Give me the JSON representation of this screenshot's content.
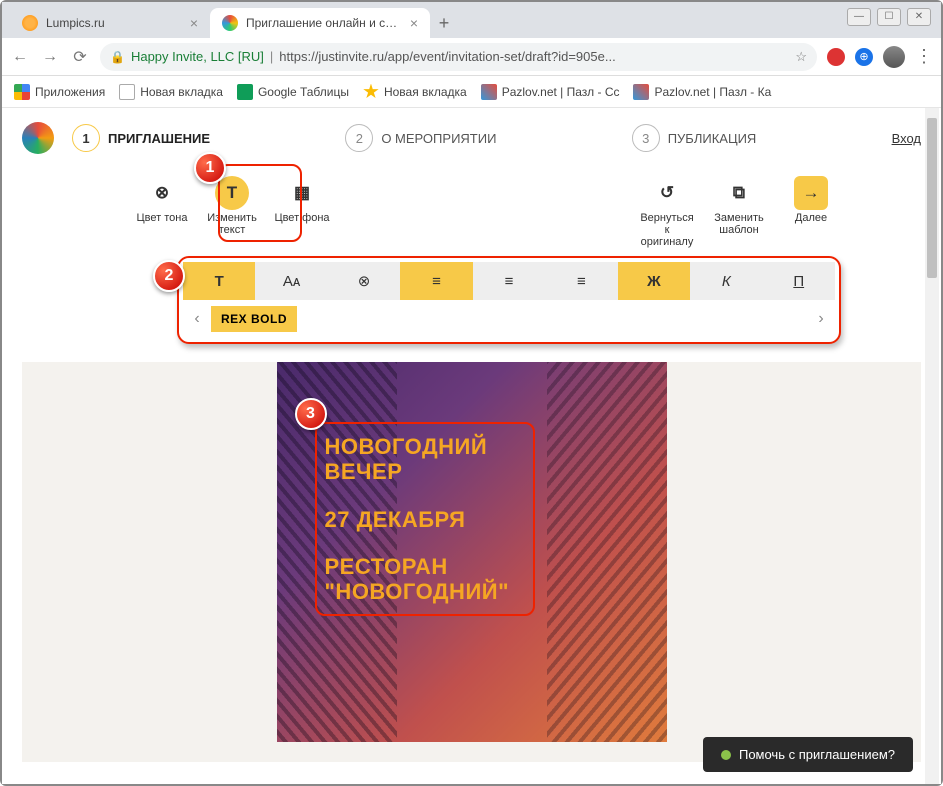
{
  "window": {
    "tabs": [
      {
        "title": "Lumpics.ru"
      },
      {
        "title": "Приглашение онлайн и сайт ме"
      }
    ],
    "url_org": "Happy Invite, LLC [RU]",
    "url_rest": "https://justinvite.ru/app/event/invitation-set/draft?id=905e..."
  },
  "bookmarks": {
    "apps": "Приложения",
    "items": [
      "Новая вкладка",
      "Google Таблицы",
      "Новая вкладка",
      "Pazlov.net | Пазл - Сс",
      "Pazlov.net | Пазл - Ка"
    ]
  },
  "steps": {
    "s1_num": "1",
    "s1_label": "ПРИГЛАШЕНИЕ",
    "s2_num": "2",
    "s2_label": "О МЕРОПРИЯТИИ",
    "s3_num": "3",
    "s3_label": "ПУБЛИКАЦИЯ",
    "login": "Вход"
  },
  "tools": {
    "color_tone": "Цвет тона",
    "edit_text": "Изменить текст",
    "bg_color": "Цвет фона",
    "revert": "Вернуться к оригиналу",
    "replace": "Заменить шаблон",
    "next": "Далее"
  },
  "text_toolbar": {
    "T": "T",
    "Aa": "Aᴀ",
    "rgb": "⊗",
    "align_left": "≡",
    "align_center": "≡",
    "align_right": "≡",
    "bold": "Ж",
    "italic": "К",
    "underline": "П",
    "font_name": "REX BOLD"
  },
  "badges": {
    "b1": "1",
    "b2": "2",
    "b3": "3"
  },
  "invite_text": {
    "l1": "НОВОГОДНИЙ",
    "l2": "ВЕЧЕР",
    "l3": "27 ДЕКАБРЯ",
    "l4": "РЕСТОРАН",
    "l5": "\"НОВОГОДНИЙ\""
  },
  "help": "Помочь с приглашением?"
}
